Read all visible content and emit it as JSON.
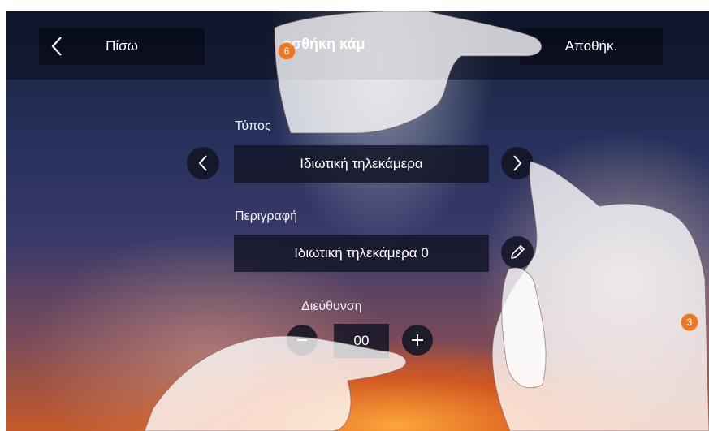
{
  "header": {
    "back_label": "Πίσω",
    "title": "οσθήκη κάμ",
    "save_label": "Αποθήκ."
  },
  "form": {
    "type_label": "Τύπος",
    "type_value": "Ιδιωτική τηλεκάμερα",
    "description_label": "Περιγραφή",
    "description_value": "Ιδιωτική τηλεκάμερα 0",
    "address_label": "Διεύθυνση",
    "address_value": "00"
  },
  "callouts": {
    "badge_top": "6",
    "badge_right": "3"
  },
  "colors": {
    "accent": "#e8782a",
    "bar": "#080c1c"
  },
  "icons": [
    "chevron-left-icon",
    "chevron-right-icon",
    "pencil-icon",
    "plus-icon",
    "minus-icon"
  ]
}
